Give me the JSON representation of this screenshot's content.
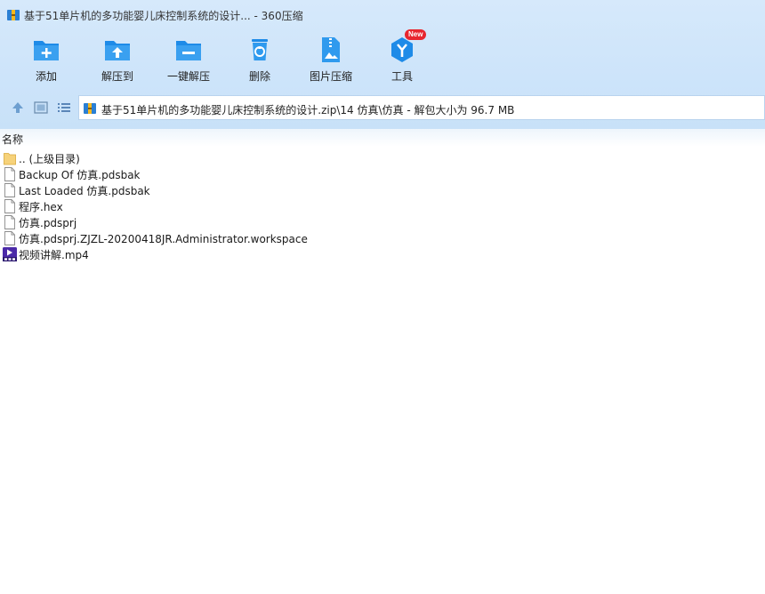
{
  "window": {
    "title": "基于51单片机的多功能婴儿床控制系统的设计... - 360压缩"
  },
  "toolbar": {
    "buttons": [
      {
        "label": "添加",
        "icon": "add-icon"
      },
      {
        "label": "解压到",
        "icon": "extract-to-icon"
      },
      {
        "label": "一键解压",
        "icon": "one-click-extract-icon"
      },
      {
        "label": "删除",
        "icon": "delete-icon"
      },
      {
        "label": "图片压缩",
        "icon": "image-compress-icon"
      },
      {
        "label": "工具",
        "icon": "tools-icon",
        "badge": "New"
      }
    ]
  },
  "address": {
    "path": "基于51单片机的多功能婴儿床控制系统的设计.zip\\14 仿真\\仿真 - 解包大小为 96.7 MB"
  },
  "list": {
    "column_name": "名称",
    "items": [
      {
        "name": ".. (上级目录)",
        "type": "folder"
      },
      {
        "name": "Backup Of 仿真.pdsbak",
        "type": "file"
      },
      {
        "name": "Last Loaded 仿真.pdsbak",
        "type": "file"
      },
      {
        "name": "程序.hex",
        "type": "file"
      },
      {
        "name": "仿真.pdsprj",
        "type": "file"
      },
      {
        "name": "仿真.pdsprj.ZJZL-20200418JR.Administrator.workspace",
        "type": "file"
      },
      {
        "name": "视频讲解.mp4",
        "type": "video"
      }
    ]
  },
  "colors": {
    "toolbar_bg": "#cde4fa",
    "icon_blue": "#1e8be8",
    "badge_red": "#e8262f"
  }
}
